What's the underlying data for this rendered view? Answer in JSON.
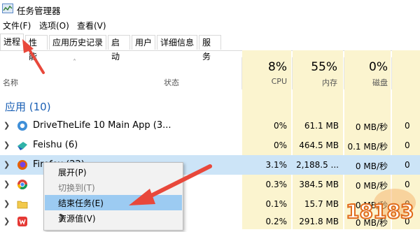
{
  "window": {
    "title": "任务管理器"
  },
  "menu": [
    "文件(F)",
    "选项(O)",
    "查看(V)"
  ],
  "tabs": [
    "进程",
    "性能",
    "应用历史记录",
    "启动",
    "用户",
    "详细信息",
    "服务"
  ],
  "header": {
    "name_label": "名称",
    "status_label": "状态",
    "cpu_pct": "8%",
    "cpu_label": "CPU",
    "mem_pct": "55%",
    "mem_label": "内存",
    "disk_pct": "0%",
    "disk_label": "磁盘"
  },
  "group": {
    "label": "应用 (10)"
  },
  "rows": [
    {
      "name": "DriveTheLife 10 Main App (3...",
      "cpu": "0%",
      "mem": "61.1 MB",
      "disk": "0 MB/秒",
      "net": "0"
    },
    {
      "name": "Feishu (6)",
      "cpu": "0%",
      "mem": "464.5 MB",
      "disk": "0.1 MB/秒",
      "net": "0"
    },
    {
      "name": "Firefox (22)",
      "cpu": "3.1%",
      "mem": "2,188.5 ...",
      "disk": "0 MB/秒",
      "net": "0"
    },
    {
      "name": "",
      "cpu": "0.3%",
      "mem": "384.5 MB",
      "disk": "0 MB/秒",
      "net": "0"
    },
    {
      "name": "",
      "cpu": "0.1%",
      "mem": "15.7 MB",
      "disk": "0 MB/秒",
      "net": "0"
    },
    {
      "name": "",
      "cpu": "0.2%",
      "mem": "291.8 MB",
      "disk": "0 MB/秒",
      "net": "0"
    }
  ],
  "context_menu": [
    {
      "label": "展开(P)"
    },
    {
      "label": "切换到(T)"
    },
    {
      "label": "结束任务(E)"
    },
    {
      "label": "资源值(V)"
    }
  ],
  "watermark": {
    "text": "18183"
  },
  "colors": {
    "accent": "#1a5fb4",
    "highlight": "#fbf4cf",
    "selected": "#cce4f7",
    "arrow": "#e8483b"
  }
}
